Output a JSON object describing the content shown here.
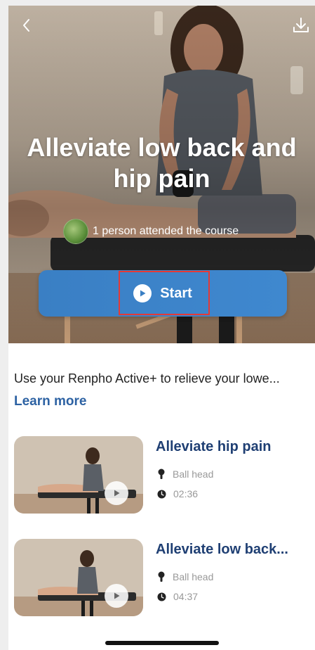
{
  "hero": {
    "title": "Alleviate low back and hip pain",
    "attended_text": "1 person attended the course"
  },
  "start_button": {
    "label": "Start"
  },
  "description": "Use your Renpho Active+ to relieve your lowe...",
  "learn_more": "Learn more",
  "courses": [
    {
      "title": "Alleviate hip pain",
      "attachment": "Ball head",
      "duration": "02:36"
    },
    {
      "title": "Alleviate low back...",
      "attachment": "Ball head",
      "duration": "04:37"
    }
  ],
  "icons": {
    "back": "chevron-left-icon",
    "download": "download-icon",
    "start": "play-circle-icon",
    "attachment": "massage-head-icon",
    "duration": "clock-icon"
  },
  "colors": {
    "accent": "#3a7fc4",
    "title_blue": "#1f3f73",
    "link_blue": "#2d62a3",
    "highlight": "#e53935"
  }
}
